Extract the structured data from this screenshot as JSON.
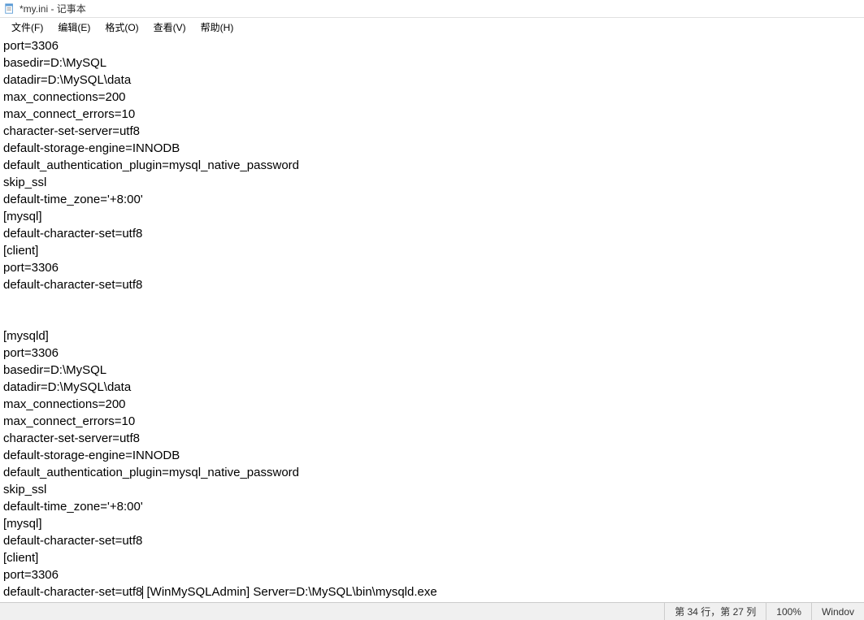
{
  "window": {
    "title": "*my.ini - 记事本"
  },
  "menu": {
    "file": "文件(F)",
    "edit": "编辑(E)",
    "format": "格式(O)",
    "view": "查看(V)",
    "help": "帮助(H)"
  },
  "content": {
    "line1": "port=3306",
    "line2": "basedir=D:\\MySQL",
    "line3": "datadir=D:\\MySQL\\data",
    "line4": "max_connections=200",
    "line5": "max_connect_errors=10",
    "line6": "character-set-server=utf8",
    "line7": "default-storage-engine=INNODB",
    "line8": "default_authentication_plugin=mysql_native_password",
    "line9": "skip_ssl",
    "line10": "default-time_zone='+8:00'",
    "line11": "[mysql]",
    "line12": "default-character-set=utf8",
    "line13": "[client]",
    "line14": "port=3306",
    "line15": "default-character-set=utf8",
    "line16": "",
    "line17": "",
    "line18": "[mysqld]",
    "line19": "port=3306",
    "line20": "basedir=D:\\MySQL",
    "line21": "datadir=D:\\MySQL\\data",
    "line22": "max_connections=200",
    "line23": "max_connect_errors=10",
    "line24": "character-set-server=utf8",
    "line25": "default-storage-engine=INNODB",
    "line26": "default_authentication_plugin=mysql_native_password",
    "line27": "skip_ssl",
    "line28": "default-time_zone='+8:00'",
    "line29": "[mysql]",
    "line30": "default-character-set=utf8",
    "line31": "[client]",
    "line32": "port=3306",
    "line33_a": "default-character-set=utf8",
    "line33_b": " [WinMySQLAdmin] Server=D:\\MySQL\\bin\\mysqld.exe"
  },
  "statusbar": {
    "position": "第 34 行，第 27 列",
    "zoom": "100%",
    "encoding": "Windov"
  }
}
